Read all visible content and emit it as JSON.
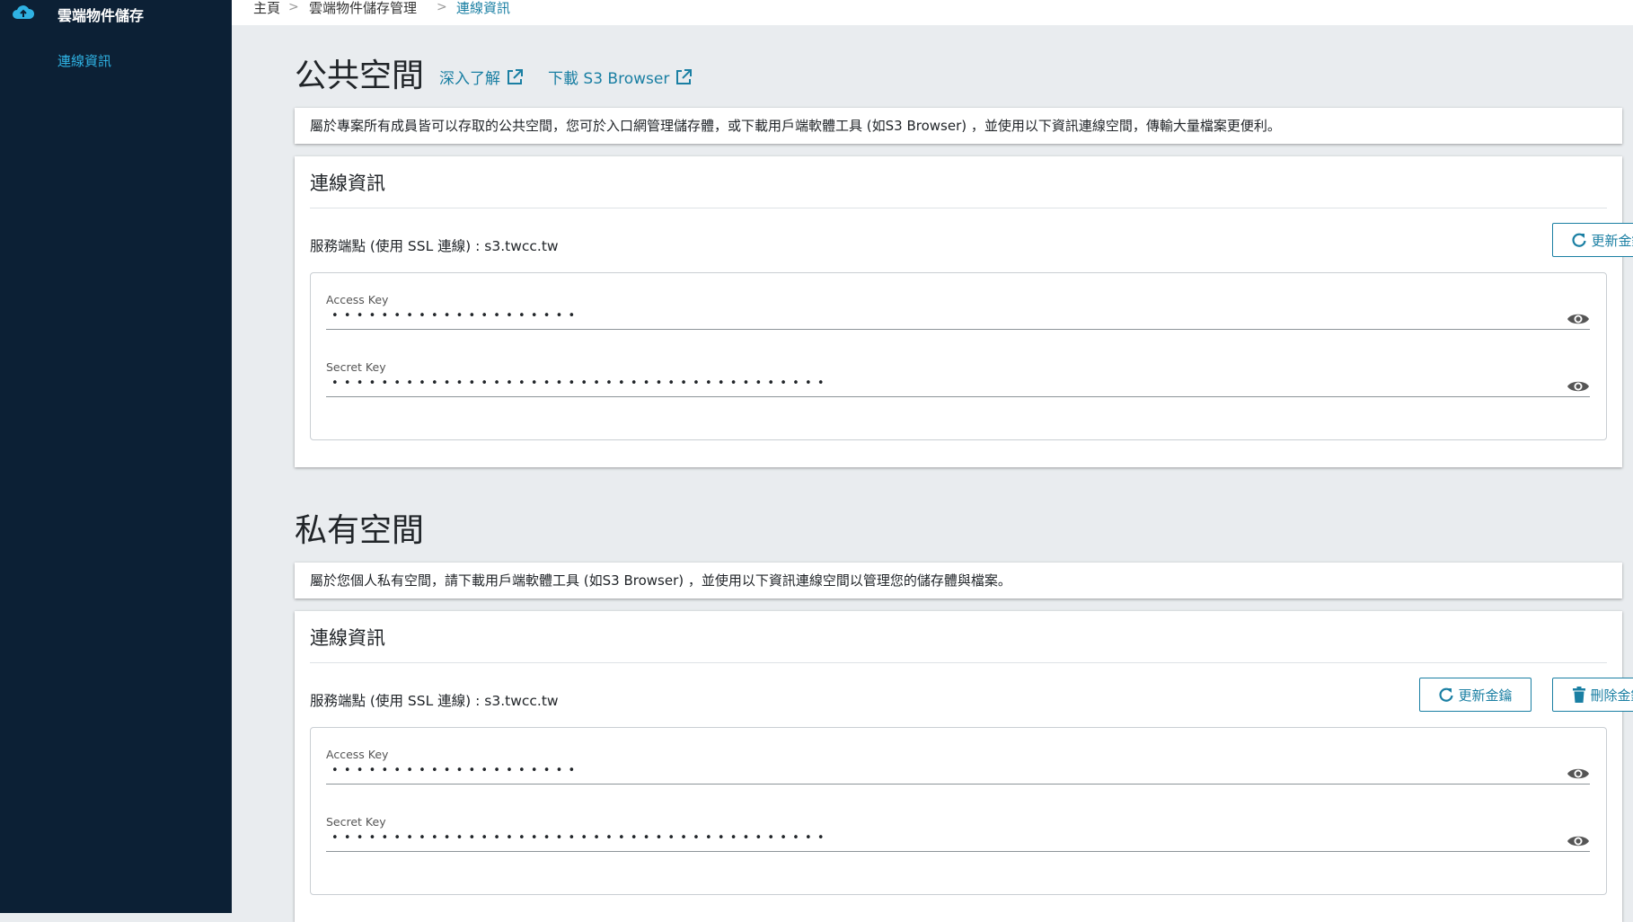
{
  "sidebar": {
    "app_title": "雲端物件儲存",
    "items": [
      {
        "label": "連線資訊"
      }
    ]
  },
  "breadcrumb": [
    {
      "label": "主頁"
    },
    {
      "label": "雲端物件儲存管理"
    },
    {
      "label": "連線資訊"
    }
  ],
  "breadcrumb_separator": ">",
  "public": {
    "title": "公共空間",
    "learn_more": "深入了解",
    "download": "下載 S3 Browser",
    "description": "屬於專案所有成員皆可以存取的公共空間，您可於入口網管理儲存體，或下載用戶端軟體工具 (如S3 Browser) ，並使用以下資訊連線空間，傳輸大量檔案更便利。",
    "card_title": "連線資訊",
    "endpoint": "服務端點 (使用 SSL 連線) : s3.twcc.tw",
    "refresh_button": "更新金鑰",
    "access_key_label": "Access Key",
    "access_key_value": "••••••••••••••••••••",
    "secret_key_label": "Secret Key",
    "secret_key_value": "••••••••••••••••••••••••••••••••••••••••"
  },
  "private": {
    "title": "私有空間",
    "description": "屬於您個人私有空間，請下載用戶端軟體工具 (如S3 Browser) ，並使用以下資訊連線空間以管理您的儲存體與檔案。",
    "card_title": "連線資訊",
    "endpoint": "服務端點 (使用 SSL 連線) : s3.twcc.tw",
    "refresh_button": "更新金鑰",
    "delete_button": "刪除金鑰",
    "access_key_label": "Access Key",
    "access_key_value": "••••••••••••••••••••",
    "secret_key_label": "Secret Key",
    "secret_key_value": "••••••••••••••••••••••••••••••••••••••••"
  },
  "colors": {
    "sidebar_bg": "#0c2035",
    "accent": "#1a7fa3",
    "sidebar_active": "#2fb2e3",
    "page_bg": "#e9ecef"
  }
}
